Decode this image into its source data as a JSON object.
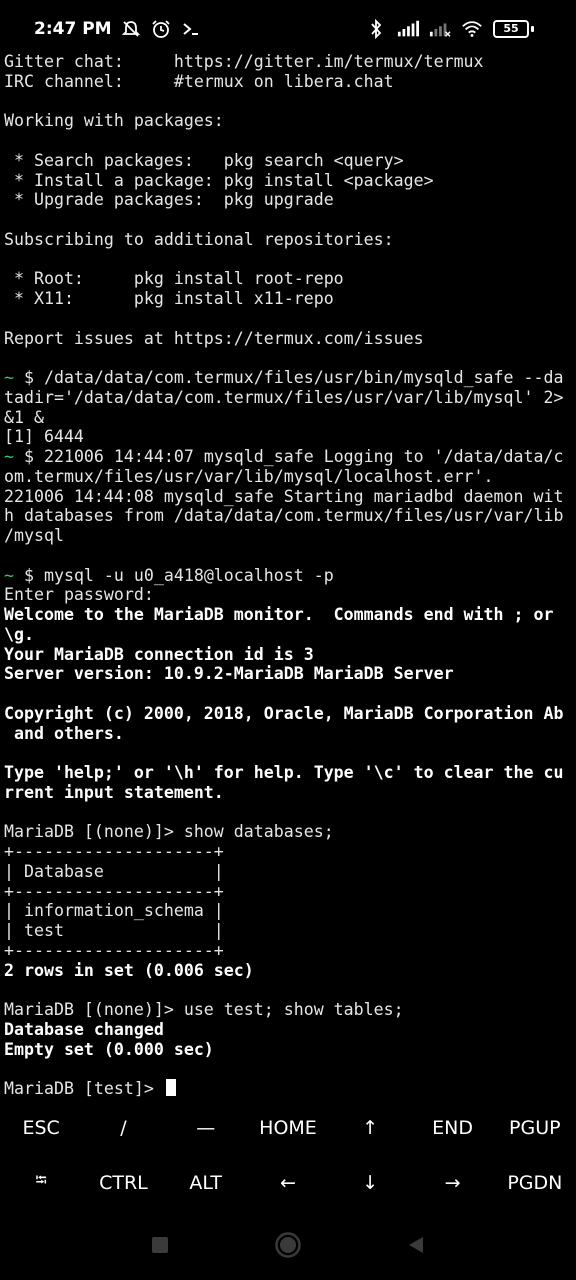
{
  "status_bar": {
    "time": "2:47 PM",
    "icons_left": [
      "muted-notifications-icon",
      "alarm-icon",
      "terminal-icon"
    ],
    "icons_right": [
      "bluetooth-icon",
      "signal-icon",
      "signal-weak-icon",
      "wifi-icon"
    ],
    "battery": "55"
  },
  "terminal": {
    "lines": [
      {
        "text": "Gitter chat:     https://gitter.im/termux/termux"
      },
      {
        "text": "IRC channel:     #termux on libera.chat"
      },
      {
        "text": ""
      },
      {
        "text": "Working with packages:"
      },
      {
        "text": ""
      },
      {
        "text": " * Search packages:   pkg search <query>"
      },
      {
        "text": " * Install a package: pkg install <package>"
      },
      {
        "text": " * Upgrade packages:  pkg upgrade"
      },
      {
        "text": ""
      },
      {
        "text": "Subscribing to additional repositories:"
      },
      {
        "text": ""
      },
      {
        "text": " * Root:     pkg install root-repo"
      },
      {
        "text": " * X11:      pkg install x11-repo"
      },
      {
        "text": ""
      },
      {
        "text": "Report issues at https://termux.com/issues"
      },
      {
        "text": ""
      },
      {
        "prompt": "~",
        "text": " $ /data/data/com.termux/files/usr/bin/mysqld_safe --da"
      },
      {
        "text": "tadir='/data/data/com.termux/files/usr/var/lib/mysql' 2>"
      },
      {
        "text": "&1 &"
      },
      {
        "text": "[1] 6444"
      },
      {
        "prompt": "~",
        "text": " $ 221006 14:44:07 mysqld_safe Logging to '/data/data/c"
      },
      {
        "text": "om.termux/files/usr/var/lib/mysql/localhost.err'."
      },
      {
        "text": "221006 14:44:08 mysqld_safe Starting mariadbd daemon wit"
      },
      {
        "text": "h databases from /data/data/com.termux/files/usr/var/lib"
      },
      {
        "text": "/mysql"
      },
      {
        "text": ""
      },
      {
        "prompt": "~",
        "text": " $ mysql -u u0_a418@localhost -p"
      },
      {
        "text": "Enter password:"
      },
      {
        "text": "Welcome to the MariaDB monitor.  Commands end with ; or",
        "bold": true
      },
      {
        "text": "\\g.",
        "bold": true
      },
      {
        "text": "Your MariaDB connection id is 3",
        "bold": true
      },
      {
        "text": "Server version: 10.9.2-MariaDB MariaDB Server",
        "bold": true
      },
      {
        "text": ""
      },
      {
        "text": "Copyright (c) 2000, 2018, Oracle, MariaDB Corporation Ab",
        "bold": true
      },
      {
        "text": " and others.",
        "bold": true
      },
      {
        "text": ""
      },
      {
        "text": "Type 'help;' or '\\h' for help. Type '\\c' to clear the cu",
        "bold": true
      },
      {
        "text": "rrent input statement.",
        "bold": true
      },
      {
        "text": ""
      },
      {
        "text": "MariaDB [(none)]> show databases;"
      },
      {
        "text": "+--------------------+"
      },
      {
        "text": "| Database           |"
      },
      {
        "text": "+--------------------+"
      },
      {
        "text": "| information_schema |"
      },
      {
        "text": "| test               |"
      },
      {
        "text": "+--------------------+"
      },
      {
        "text": "2 rows in set (0.006 sec)",
        "bold": true
      },
      {
        "text": ""
      },
      {
        "text": "MariaDB [(none)]> use test; show tables;"
      },
      {
        "text": "Database changed",
        "bold": true
      },
      {
        "text": "Empty set (0.000 sec)",
        "bold": true
      },
      {
        "text": ""
      },
      {
        "text": "MariaDB [test]> ",
        "cursor": true
      }
    ]
  },
  "extra_keys": {
    "row1": [
      "ESC",
      "/",
      "—",
      "HOME",
      "↑",
      "END",
      "PGUP"
    ],
    "row2": [
      "⭾",
      "CTRL",
      "ALT",
      "←",
      "↓",
      "→",
      "PGDN"
    ]
  },
  "nav_bar": {
    "buttons": [
      "recent-apps-icon",
      "home-icon",
      "back-icon"
    ]
  }
}
